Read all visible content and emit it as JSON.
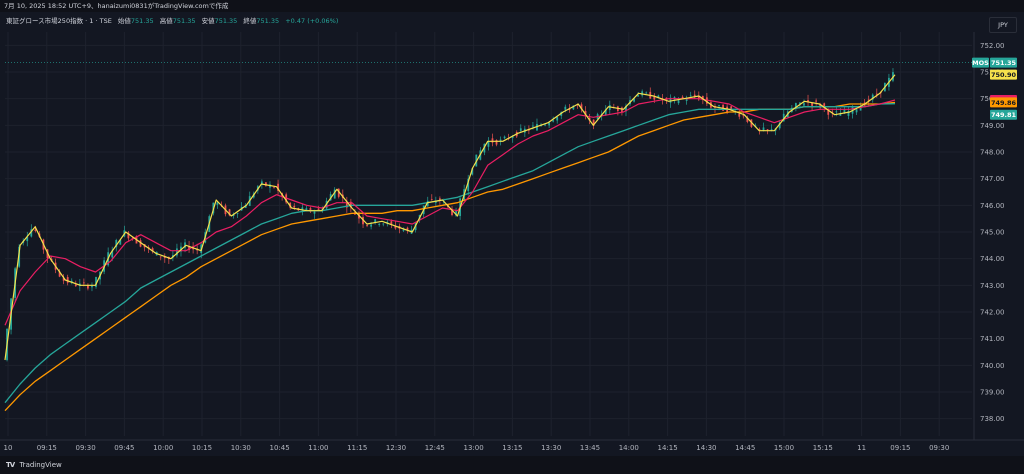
{
  "header": {
    "caption": "7月 10, 2025 18:52 UTC+9、hanaizumi0831がTradingView.comで作成"
  },
  "legend": {
    "symbol": "東証グロース市場250指数 · 1 · TSE",
    "open_label": "始値",
    "open_value": "751.35",
    "high_label": "高値",
    "high_value": "751.35",
    "low_label": "安値",
    "low_value": "751.35",
    "close_label": "終値",
    "close_value": "751.35",
    "change": "+0.47 (+0.06%)"
  },
  "currency_button": "JPY",
  "footer": {
    "logo": "TV",
    "brand": "TradingView"
  },
  "chart_data": {
    "type": "candlestick",
    "x_ticks": [
      "10",
      "09:15",
      "09:30",
      "09:45",
      "10:00",
      "10:15",
      "10:30",
      "10:45",
      "11:00",
      "11:15",
      "12:30",
      "12:45",
      "13:00",
      "13:15",
      "13:30",
      "13:45",
      "14:00",
      "14:15",
      "14:30",
      "14:45",
      "15:00",
      "15:15",
      "11",
      "09:15",
      "09:30"
    ],
    "y_ticks": [
      752.0,
      751.0,
      750.0,
      749.0,
      748.0,
      747.0,
      746.0,
      745.0,
      744.0,
      743.0,
      742.0,
      741.0,
      740.0,
      739.0,
      738.0
    ],
    "ylim": [
      737.5,
      752.5
    ],
    "price_labels": [
      {
        "text": "MOS",
        "color": "#26a69a"
      },
      {
        "text": "751.35",
        "color": "#26a69a"
      },
      {
        "text": "750.90",
        "color": "#f5e14c"
      },
      {
        "text": "749.95",
        "color": "#e91e63"
      },
      {
        "text": "749.86",
        "color": "#ff9800"
      },
      {
        "text": "749.81",
        "color": "#26a69a"
      }
    ],
    "series_colors": {
      "up": "#26a69a",
      "down": "#ef5350",
      "fast": "#f5e14c",
      "mid": "#e91e63",
      "slow": "#26a69a",
      "slowest": "#ff9800"
    },
    "fast_line": [
      [
        0,
        740.2
      ],
      [
        1,
        744.5
      ],
      [
        2,
        745.2
      ],
      [
        3,
        744.0
      ],
      [
        4,
        743.2
      ],
      [
        5,
        743.0
      ],
      [
        6,
        743.0
      ],
      [
        7,
        744.2
      ],
      [
        8,
        745.0
      ],
      [
        9,
        744.6
      ],
      [
        10,
        744.2
      ],
      [
        11,
        744.0
      ],
      [
        12,
        744.5
      ],
      [
        13,
        744.3
      ],
      [
        14,
        746.2
      ],
      [
        15,
        745.6
      ],
      [
        16,
        746.0
      ],
      [
        17,
        746.8
      ],
      [
        18,
        746.7
      ],
      [
        19,
        745.9
      ],
      [
        20,
        745.8
      ],
      [
        21,
        745.8
      ],
      [
        22,
        746.6
      ],
      [
        23,
        745.9
      ],
      [
        24,
        745.3
      ],
      [
        25,
        745.4
      ],
      [
        26,
        745.2
      ],
      [
        27,
        745.0
      ],
      [
        28,
        746.1
      ],
      [
        29,
        746.2
      ],
      [
        30,
        745.6
      ],
      [
        31,
        747.4
      ],
      [
        32,
        748.4
      ],
      [
        33,
        748.4
      ],
      [
        34,
        748.7
      ],
      [
        35,
        748.9
      ],
      [
        36,
        749.1
      ],
      [
        37,
        749.5
      ],
      [
        38,
        749.8
      ],
      [
        39,
        749.0
      ],
      [
        40,
        749.7
      ],
      [
        41,
        749.6
      ],
      [
        42,
        750.2
      ],
      [
        43,
        750.1
      ],
      [
        44,
        749.9
      ],
      [
        45,
        750.0
      ],
      [
        46,
        750.1
      ],
      [
        47,
        749.7
      ],
      [
        48,
        749.6
      ],
      [
        49,
        749.4
      ],
      [
        50,
        748.8
      ],
      [
        51,
        748.8
      ],
      [
        52,
        749.5
      ],
      [
        53,
        749.9
      ],
      [
        54,
        749.8
      ],
      [
        55,
        749.4
      ],
      [
        56,
        749.5
      ],
      [
        57,
        749.8
      ],
      [
        58,
        750.2
      ],
      [
        59,
        750.9
      ]
    ],
    "mid_line": [
      [
        0,
        741.5
      ],
      [
        1,
        742.8
      ],
      [
        2,
        743.5
      ],
      [
        3,
        744.1
      ],
      [
        4,
        744.0
      ],
      [
        5,
        743.7
      ],
      [
        6,
        743.5
      ],
      [
        7,
        743.9
      ],
      [
        8,
        744.6
      ],
      [
        9,
        744.9
      ],
      [
        10,
        744.6
      ],
      [
        11,
        744.3
      ],
      [
        12,
        744.3
      ],
      [
        13,
        744.6
      ],
      [
        14,
        745.0
      ],
      [
        15,
        745.2
      ],
      [
        16,
        745.6
      ],
      [
        17,
        746.1
      ],
      [
        18,
        746.4
      ],
      [
        19,
        746.2
      ],
      [
        20,
        746.0
      ],
      [
        21,
        745.9
      ],
      [
        22,
        746.1
      ],
      [
        23,
        746.1
      ],
      [
        24,
        745.6
      ],
      [
        25,
        745.5
      ],
      [
        26,
        745.4
      ],
      [
        27,
        745.3
      ],
      [
        28,
        745.6
      ],
      [
        29,
        745.9
      ],
      [
        30,
        745.8
      ],
      [
        31,
        746.5
      ],
      [
        32,
        747.5
      ],
      [
        33,
        747.9
      ],
      [
        34,
        748.3
      ],
      [
        35,
        748.6
      ],
      [
        36,
        748.8
      ],
      [
        37,
        749.1
      ],
      [
        38,
        749.4
      ],
      [
        39,
        749.3
      ],
      [
        40,
        749.4
      ],
      [
        41,
        749.5
      ],
      [
        42,
        749.8
      ],
      [
        43,
        749.9
      ],
      [
        44,
        750.0
      ],
      [
        45,
        750.0
      ],
      [
        46,
        750.0
      ],
      [
        47,
        749.9
      ],
      [
        48,
        749.8
      ],
      [
        49,
        749.5
      ],
      [
        50,
        749.3
      ],
      [
        51,
        749.1
      ],
      [
        52,
        749.3
      ],
      [
        53,
        749.5
      ],
      [
        54,
        749.6
      ],
      [
        55,
        749.6
      ],
      [
        56,
        749.6
      ],
      [
        57,
        749.7
      ],
      [
        58,
        749.8
      ],
      [
        59,
        749.95
      ]
    ],
    "slow_line": [
      [
        0,
        738.6
      ],
      [
        1,
        739.3
      ],
      [
        2,
        739.9
      ],
      [
        3,
        740.4
      ],
      [
        4,
        740.8
      ],
      [
        5,
        741.2
      ],
      [
        6,
        741.6
      ],
      [
        7,
        742.0
      ],
      [
        8,
        742.4
      ],
      [
        9,
        742.9
      ],
      [
        10,
        743.2
      ],
      [
        11,
        743.5
      ],
      [
        12,
        743.8
      ],
      [
        13,
        744.1
      ],
      [
        14,
        744.4
      ],
      [
        15,
        744.7
      ],
      [
        16,
        745.0
      ],
      [
        17,
        745.3
      ],
      [
        18,
        745.5
      ],
      [
        19,
        745.7
      ],
      [
        20,
        745.8
      ],
      [
        21,
        745.8
      ],
      [
        22,
        745.9
      ],
      [
        23,
        746.0
      ],
      [
        24,
        746.0
      ],
      [
        25,
        746.0
      ],
      [
        26,
        746.0
      ],
      [
        27,
        746.0
      ],
      [
        28,
        746.1
      ],
      [
        29,
        746.2
      ],
      [
        30,
        746.3
      ],
      [
        31,
        746.5
      ],
      [
        32,
        746.7
      ],
      [
        33,
        746.9
      ],
      [
        34,
        747.1
      ],
      [
        35,
        747.3
      ],
      [
        36,
        747.6
      ],
      [
        37,
        747.9
      ],
      [
        38,
        748.2
      ],
      [
        39,
        748.4
      ],
      [
        40,
        748.6
      ],
      [
        41,
        748.8
      ],
      [
        42,
        749.0
      ],
      [
        43,
        749.2
      ],
      [
        44,
        749.4
      ],
      [
        45,
        749.5
      ],
      [
        46,
        749.6
      ],
      [
        47,
        749.6
      ],
      [
        48,
        749.6
      ],
      [
        49,
        749.6
      ],
      [
        50,
        749.6
      ],
      [
        51,
        749.6
      ],
      [
        52,
        749.6
      ],
      [
        53,
        749.7
      ],
      [
        54,
        749.7
      ],
      [
        55,
        749.7
      ],
      [
        56,
        749.7
      ],
      [
        57,
        749.7
      ],
      [
        58,
        749.8
      ],
      [
        59,
        749.81
      ]
    ],
    "slowest_line": [
      [
        0,
        738.3
      ],
      [
        1,
        738.9
      ],
      [
        2,
        739.4
      ],
      [
        3,
        739.8
      ],
      [
        4,
        740.2
      ],
      [
        5,
        740.6
      ],
      [
        6,
        741.0
      ],
      [
        7,
        741.4
      ],
      [
        8,
        741.8
      ],
      [
        9,
        742.2
      ],
      [
        10,
        742.6
      ],
      [
        11,
        743.0
      ],
      [
        12,
        743.3
      ],
      [
        13,
        743.7
      ],
      [
        14,
        744.0
      ],
      [
        15,
        744.3
      ],
      [
        16,
        744.6
      ],
      [
        17,
        744.9
      ],
      [
        18,
        745.1
      ],
      [
        19,
        745.3
      ],
      [
        20,
        745.4
      ],
      [
        21,
        745.5
      ],
      [
        22,
        745.6
      ],
      [
        23,
        745.7
      ],
      [
        24,
        745.7
      ],
      [
        25,
        745.7
      ],
      [
        26,
        745.8
      ],
      [
        27,
        745.8
      ],
      [
        28,
        745.9
      ],
      [
        29,
        746.0
      ],
      [
        30,
        746.1
      ],
      [
        31,
        746.3
      ],
      [
        32,
        746.5
      ],
      [
        33,
        746.6
      ],
      [
        34,
        746.8
      ],
      [
        35,
        747.0
      ],
      [
        36,
        747.2
      ],
      [
        37,
        747.4
      ],
      [
        38,
        747.6
      ],
      [
        39,
        747.8
      ],
      [
        40,
        748.0
      ],
      [
        41,
        748.3
      ],
      [
        42,
        748.6
      ],
      [
        43,
        748.8
      ],
      [
        44,
        749.0
      ],
      [
        45,
        749.2
      ],
      [
        46,
        749.3
      ],
      [
        47,
        749.4
      ],
      [
        48,
        749.5
      ],
      [
        49,
        749.5
      ],
      [
        50,
        749.6
      ],
      [
        51,
        749.6
      ],
      [
        52,
        749.6
      ],
      [
        53,
        749.7
      ],
      [
        54,
        749.7
      ],
      [
        55,
        749.7
      ],
      [
        56,
        749.8
      ],
      [
        57,
        749.8
      ],
      [
        58,
        749.8
      ],
      [
        59,
        749.86
      ]
    ]
  }
}
